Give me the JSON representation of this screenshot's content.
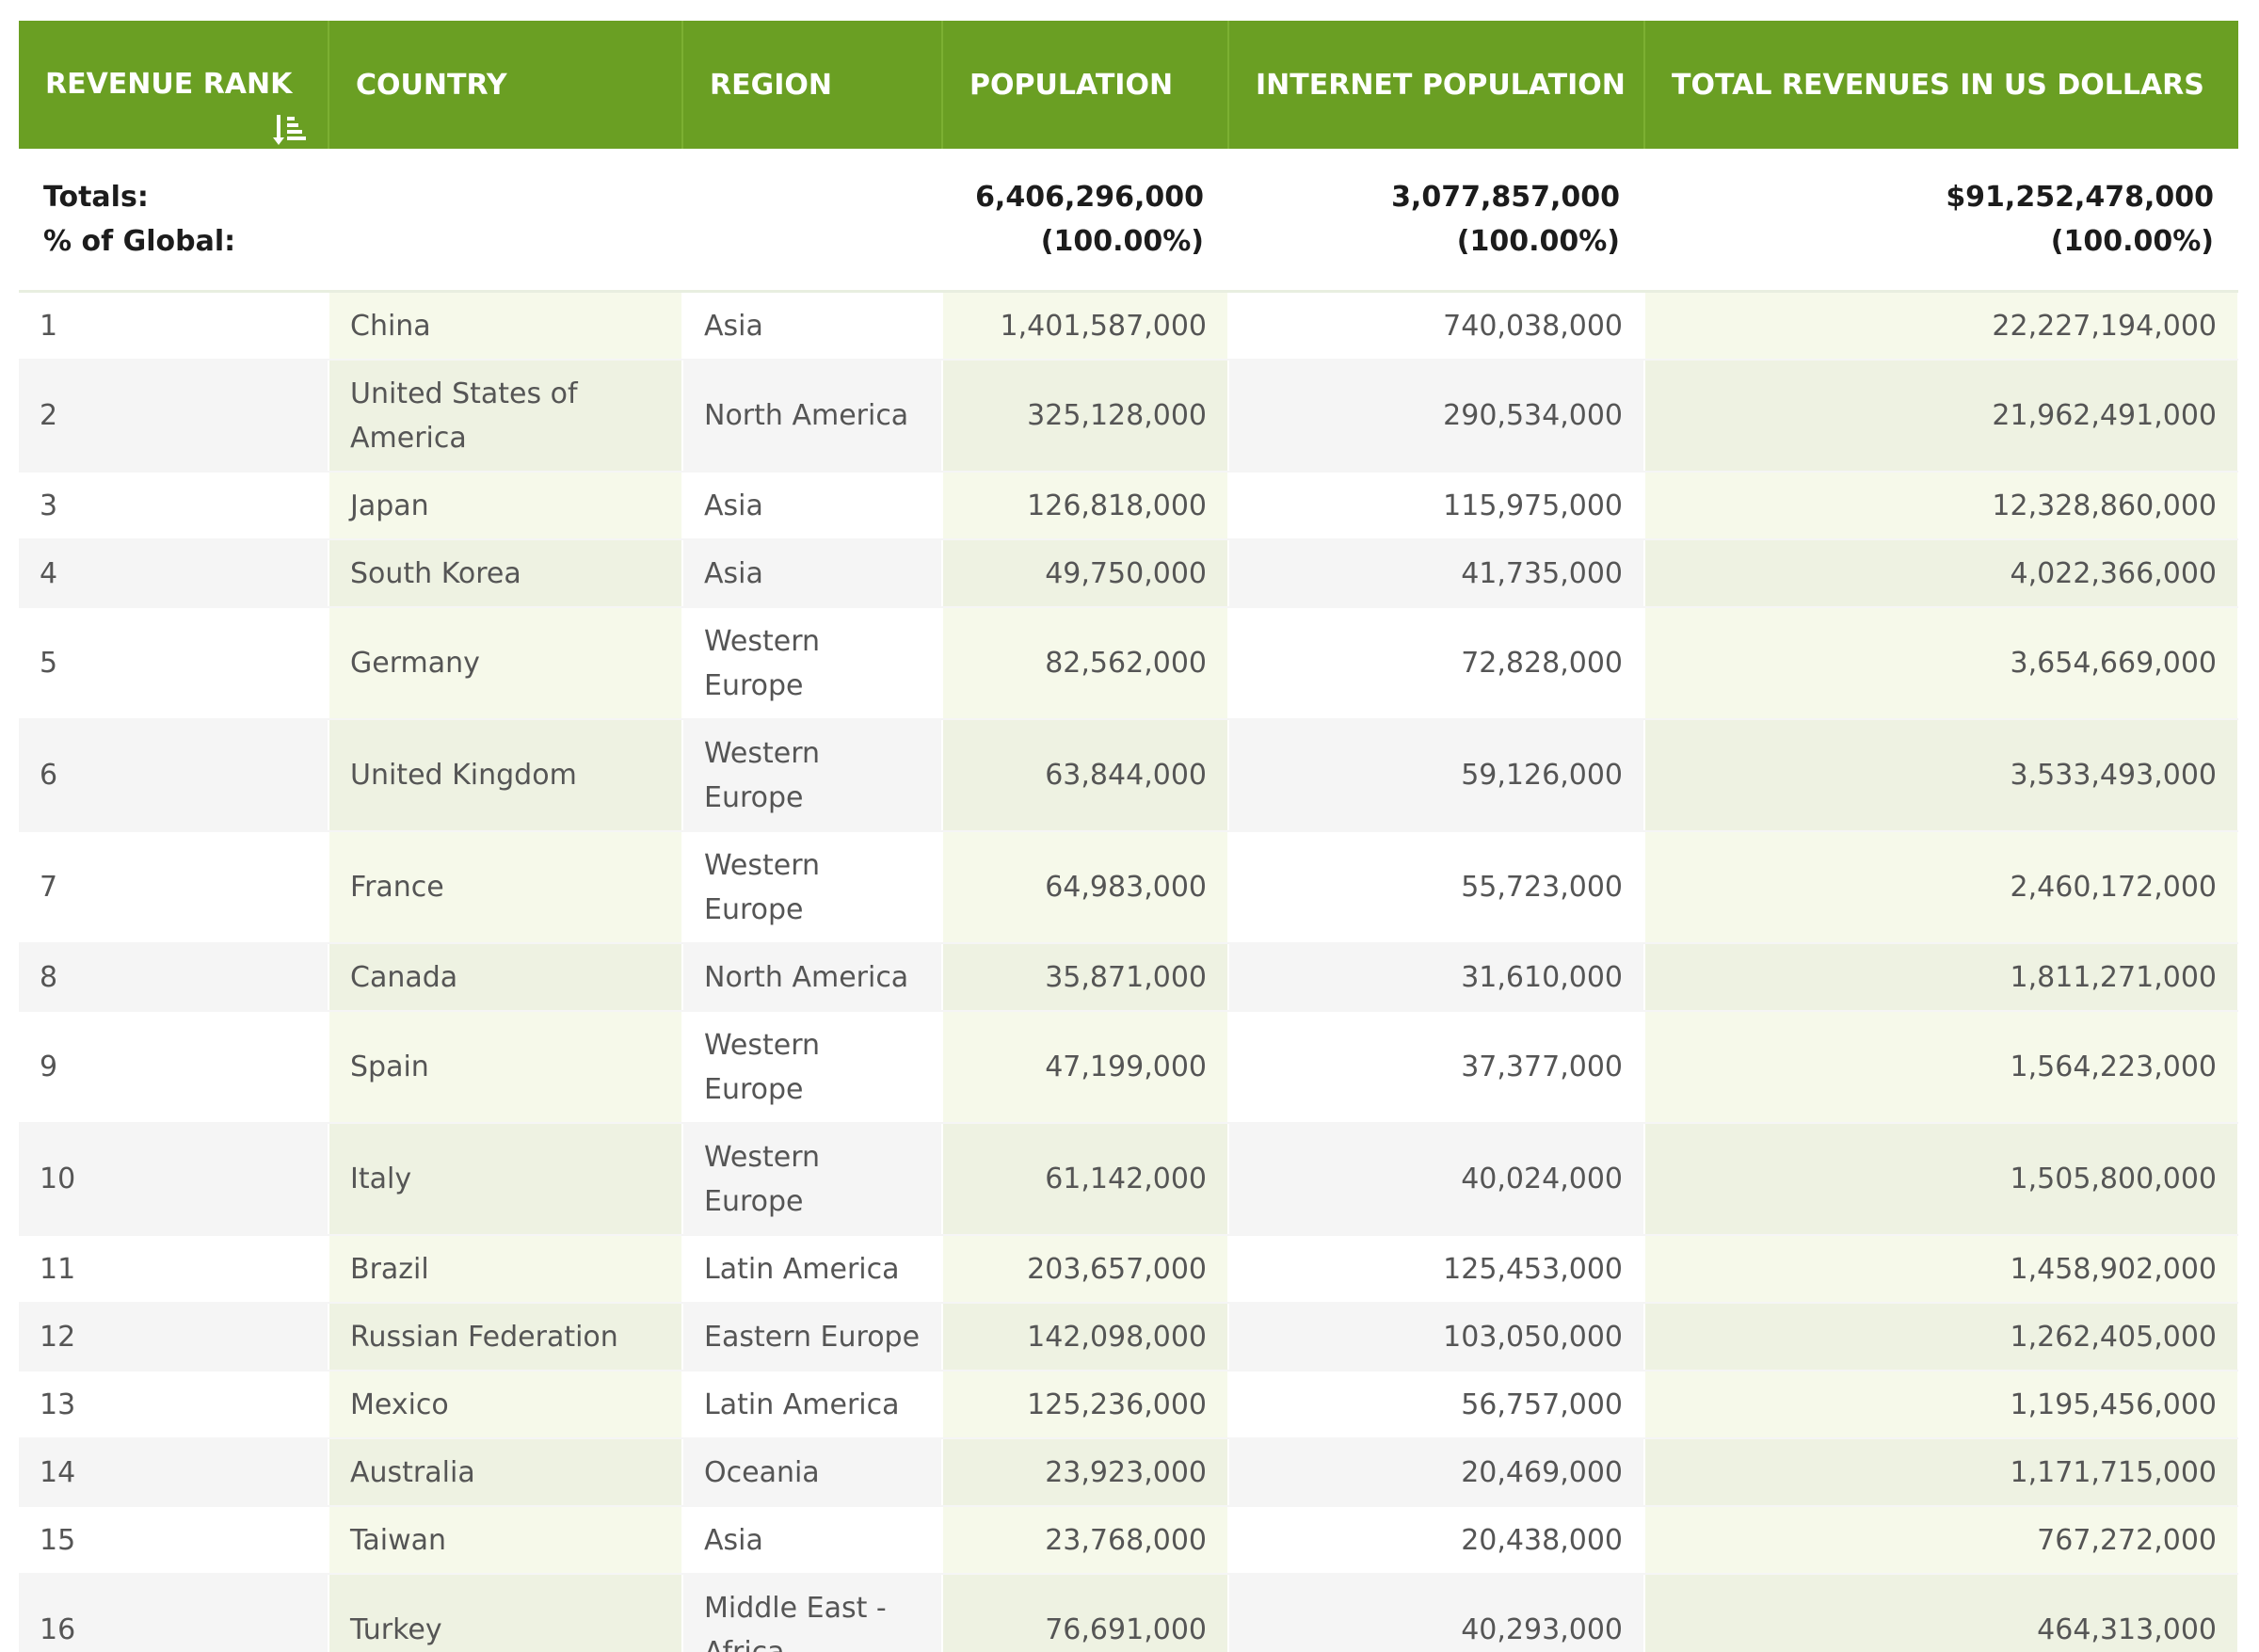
{
  "header": {
    "rank": "REVENUE RANK",
    "country": "COUNTRY",
    "region": "REGION",
    "population": "POPULATION",
    "internet_population": "INTERNET POPULATION",
    "total_revenues": "TOTAL REVENUES IN US DOLLARS",
    "sort_icon": "sort-descending-icon"
  },
  "totals": {
    "label_totals": "Totals:",
    "label_percent": "% of Global:",
    "population": "6,406,296,000",
    "population_pct": "(100.00%)",
    "internet_population": "3,077,857,000",
    "internet_population_pct": "(100.00%)",
    "revenues": "$91,252,478,000",
    "revenues_pct": "(100.00%)"
  },
  "rows": [
    {
      "rank": "1",
      "country": "China",
      "region": "Asia",
      "population": "1,401,587,000",
      "internet": "740,038,000",
      "revenue": "22,227,194,000"
    },
    {
      "rank": "2",
      "country": "United States of America",
      "region": "North America",
      "population": "325,128,000",
      "internet": "290,534,000",
      "revenue": "21,962,491,000"
    },
    {
      "rank": "3",
      "country": "Japan",
      "region": "Asia",
      "population": "126,818,000",
      "internet": "115,975,000",
      "revenue": "12,328,860,000"
    },
    {
      "rank": "4",
      "country": "South Korea",
      "region": "Asia",
      "population": "49,750,000",
      "internet": "41,735,000",
      "revenue": "4,022,366,000"
    },
    {
      "rank": "5",
      "country": "Germany",
      "region": "Western Europe",
      "population": "82,562,000",
      "internet": "72,828,000",
      "revenue": "3,654,669,000"
    },
    {
      "rank": "6",
      "country": "United Kingdom",
      "region": "Western Europe",
      "population": "63,844,000",
      "internet": "59,126,000",
      "revenue": "3,533,493,000"
    },
    {
      "rank": "7",
      "country": "France",
      "region": "Western Europe",
      "population": "64,983,000",
      "internet": "55,723,000",
      "revenue": "2,460,172,000"
    },
    {
      "rank": "8",
      "country": "Canada",
      "region": "North America",
      "population": "35,871,000",
      "internet": "31,610,000",
      "revenue": "1,811,271,000"
    },
    {
      "rank": "9",
      "country": "Spain",
      "region": "Western Europe",
      "population": "47,199,000",
      "internet": "37,377,000",
      "revenue": "1,564,223,000"
    },
    {
      "rank": "10",
      "country": "Italy",
      "region": "Western Europe",
      "population": "61,142,000",
      "internet": "40,024,000",
      "revenue": "1,505,800,000"
    },
    {
      "rank": "11",
      "country": "Brazil",
      "region": "Latin America",
      "population": "203,657,000",
      "internet": "125,453,000",
      "revenue": "1,458,902,000"
    },
    {
      "rank": "12",
      "country": "Russian Federation",
      "region": "Eastern Europe",
      "population": "142,098,000",
      "internet": "103,050,000",
      "revenue": "1,262,405,000"
    },
    {
      "rank": "13",
      "country": "Mexico",
      "region": "Latin America",
      "population": "125,236,000",
      "internet": "56,757,000",
      "revenue": "1,195,456,000"
    },
    {
      "rank": "14",
      "country": "Australia",
      "region": "Oceania",
      "population": "23,923,000",
      "internet": "20,469,000",
      "revenue": "1,171,715,000"
    },
    {
      "rank": "15",
      "country": "Taiwan",
      "region": "Asia",
      "population": "23,768,000",
      "internet": "20,438,000",
      "revenue": "767,272,000"
    },
    {
      "rank": "16",
      "country": "Turkey",
      "region": "Middle East - Africa",
      "population": "76,691,000",
      "internet": "40,293,000",
      "revenue": "464,313,000"
    }
  ]
}
